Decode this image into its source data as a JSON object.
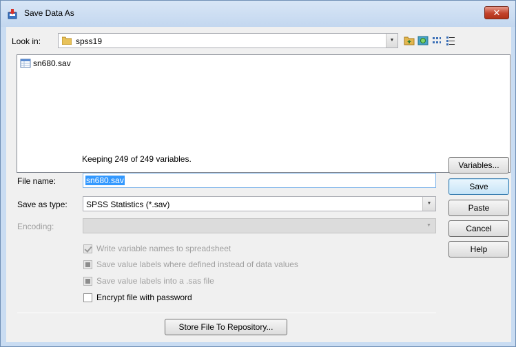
{
  "window": {
    "title": "Save Data As",
    "close_label": "✕"
  },
  "lookin": {
    "label": "Look in:",
    "value": "spss19"
  },
  "files": [
    {
      "name": "sn680.sav"
    }
  ],
  "status": {
    "keeping": "Keeping 249 of 249 variables."
  },
  "filename": {
    "label": "File name:",
    "value": "sn680.sav"
  },
  "save_as_type": {
    "label": "Save as type:",
    "value": "SPSS Statistics (*.sav)"
  },
  "encoding": {
    "label": "Encoding:",
    "value": ""
  },
  "options": {
    "write_var_names": "Write variable names to spreadsheet",
    "save_value_labels_where_defined": "Save value labels where defined instead of data values",
    "save_value_labels_sas": "Save value labels into a .sas file",
    "encrypt": "Encrypt file with password"
  },
  "buttons": {
    "variables": "Variables...",
    "save": "Save",
    "paste": "Paste",
    "cancel": "Cancel",
    "help": "Help",
    "store_repository": "Store File To Repository..."
  },
  "colors": {
    "titlebar": "#c3d7ef",
    "close_button": "#c2422b",
    "selection": "#3399ff"
  }
}
